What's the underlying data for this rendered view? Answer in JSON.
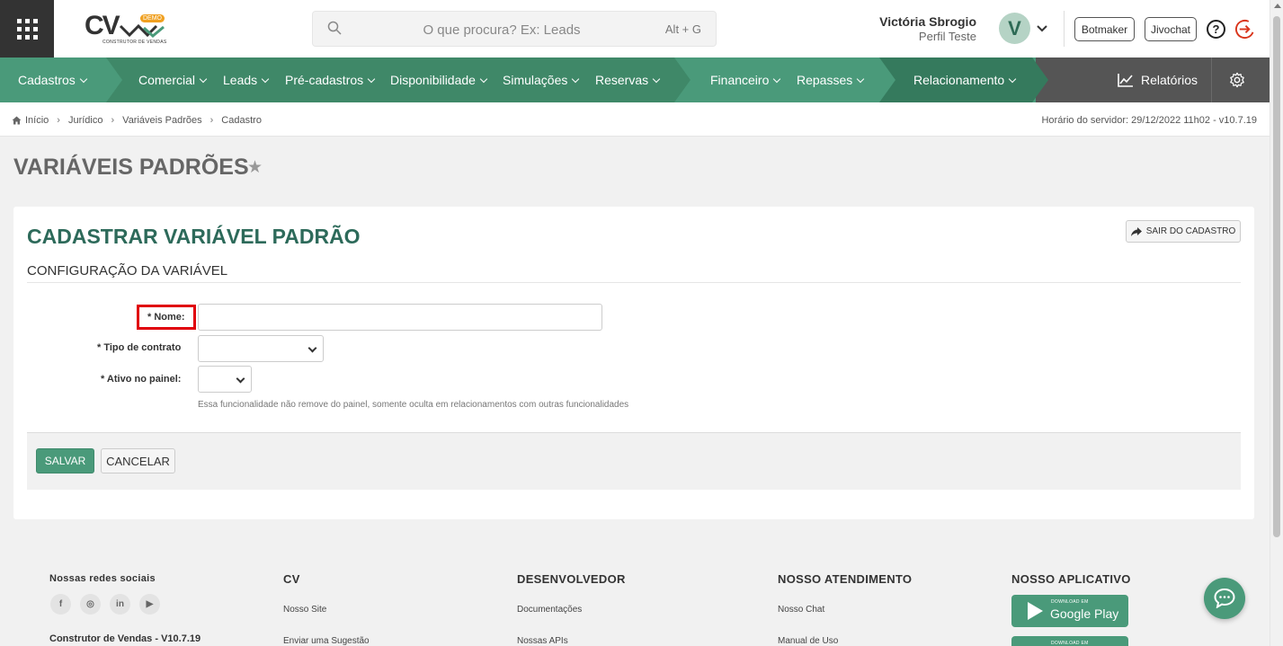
{
  "header": {
    "logo_text": "CV",
    "logo_badge": "DEMO",
    "logo_subtitle": "CONSTRUTOR DE VENDAS",
    "search_placeholder": "O que procura? Ex: Leads",
    "search_shortcut": "Alt + G",
    "user_name": "Victória Sbrogio",
    "user_profile": "Perfil Teste",
    "avatar_letter": "V",
    "botmaker_label": "Botmaker",
    "jivochat_label": "Jivochat",
    "help_glyph": "?"
  },
  "nav": {
    "items": [
      {
        "label": "Cadastros"
      },
      {
        "label": "Comercial"
      },
      {
        "label": "Leads"
      },
      {
        "label": "Pré-cadastros"
      },
      {
        "label": "Disponibilidade"
      },
      {
        "label": "Simulações"
      },
      {
        "label": "Reservas"
      },
      {
        "label": "Financeiro"
      },
      {
        "label": "Repasses"
      },
      {
        "label": "Relacionamento"
      }
    ],
    "reports_label": "Relatórios",
    "colors": {
      "primary": "#4a9a7a",
      "dark": "#3f8868",
      "darker": "#357a5d",
      "gray": "#555555"
    }
  },
  "breadcrumb": {
    "items": [
      "Início",
      "Jurídico",
      "Variáveis Padrões",
      "Cadastro"
    ],
    "server_time": "Horário do servidor: 29/12/2022 11h02 - v10.7.19"
  },
  "page": {
    "title": "VARIÁVEIS PADRÕES",
    "star_glyph": "★"
  },
  "form": {
    "title": "CADASTRAR VARIÁVEL PADRÃO",
    "exit_label": "SAIR DO CADASTRO",
    "section_title": "CONFIGURAÇÃO DA VARIÁVEL",
    "name_label": "* Nome:",
    "name_value": "",
    "contract_type_label": "* Tipo de contrato",
    "contract_type_value": "",
    "active_label": "* Ativo no painel:",
    "active_value": "",
    "active_help": "Essa funcionalidade não remove do painel, somente oculta em relacionamentos com outras funcionalidades",
    "save_label": "SALVAR",
    "cancel_label": "CANCELAR",
    "highlight_color": "#e0000a"
  },
  "footer": {
    "social_title": "Nossas redes sociais",
    "social_icons": [
      "f",
      "◎",
      "in",
      "▶"
    ],
    "version": "Construtor de Vendas - V10.7.19",
    "cv_title": "CV",
    "cv_links": [
      "Nosso Site",
      "Enviar uma Sugestão"
    ],
    "dev_title": "DESENVOLVEDOR",
    "dev_links": [
      "Documentações",
      "Nossas APIs"
    ],
    "support_title": "NOSSO ATENDIMENTO",
    "support_links": [
      "Nosso Chat",
      "Manual de Uso"
    ],
    "app_title": "NOSSO APLICATIVO",
    "google_small": "DOWNLOAD EM",
    "google_big": "Google Play",
    "apple_small": "DOWNLOAD EM"
  }
}
